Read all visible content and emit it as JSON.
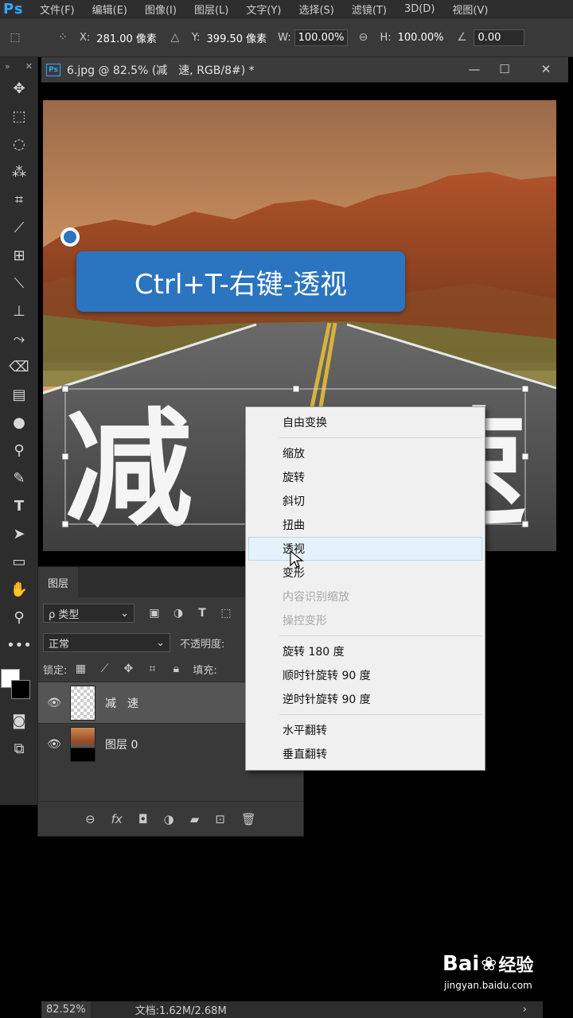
{
  "app": {
    "logo": "Ps"
  },
  "menubar": {
    "items": [
      "文件(F)",
      "编辑(E)",
      "图像(I)",
      "图层(L)",
      "文字(Y)",
      "选择(S)",
      "滤镜(T)",
      "3D(D)",
      "视图(V)"
    ]
  },
  "options": {
    "x_label": "X:",
    "x_value": "281.00 像素",
    "y_label": "Y:",
    "y_value": "399.50 像素",
    "w_label": "W:",
    "w_value": "100.00%",
    "h_label": "H:",
    "h_value": "100.00%",
    "angle_value": "0.00"
  },
  "document": {
    "title": "6.jpg @ 82.5% (减　速, RGB/8#) *",
    "ps_icon": "Ps"
  },
  "annotation": {
    "text": "Ctrl+T-右键-透视"
  },
  "canvas": {
    "layer_text_left": "减",
    "layer_text_right": "速"
  },
  "layers_panel": {
    "tab": "图层",
    "filter_label": "ρ 类型",
    "blend_mode": "正常",
    "opacity_label": "不透明度:",
    "lock_label": "锁定:",
    "fill_label": "填充:",
    "layers": [
      {
        "name": "减　速",
        "selected": true
      },
      {
        "name": "图层 0",
        "selected": false
      }
    ]
  },
  "context_menu": {
    "groups": [
      [
        {
          "label": "自由变换",
          "disabled": false
        }
      ],
      [
        {
          "label": "缩放",
          "disabled": false
        },
        {
          "label": "旋转",
          "disabled": false
        },
        {
          "label": "斜切",
          "disabled": false
        },
        {
          "label": "扭曲",
          "disabled": false
        },
        {
          "label": "透视",
          "disabled": false,
          "hover": true
        },
        {
          "label": "变形",
          "disabled": false
        },
        {
          "label": "内容识别缩放",
          "disabled": true
        },
        {
          "label": "操控变形",
          "disabled": true
        }
      ],
      [
        {
          "label": "旋转 180 度",
          "disabled": false
        },
        {
          "label": "顺时针旋转 90 度",
          "disabled": false
        },
        {
          "label": "逆时针旋转 90 度",
          "disabled": false
        }
      ],
      [
        {
          "label": "水平翻转",
          "disabled": false
        },
        {
          "label": "垂直翻转",
          "disabled": false
        }
      ]
    ]
  },
  "status": {
    "zoom": "82.52%",
    "doc": "文档:1.62M/2.68M",
    "arrow": "›"
  },
  "watermark": {
    "brand": "Bai",
    "brand2": "经验",
    "url": "jingyan.baidu.com"
  },
  "colors": {
    "accent": "#2b74c0",
    "ps_blue": "#31a8ff"
  }
}
